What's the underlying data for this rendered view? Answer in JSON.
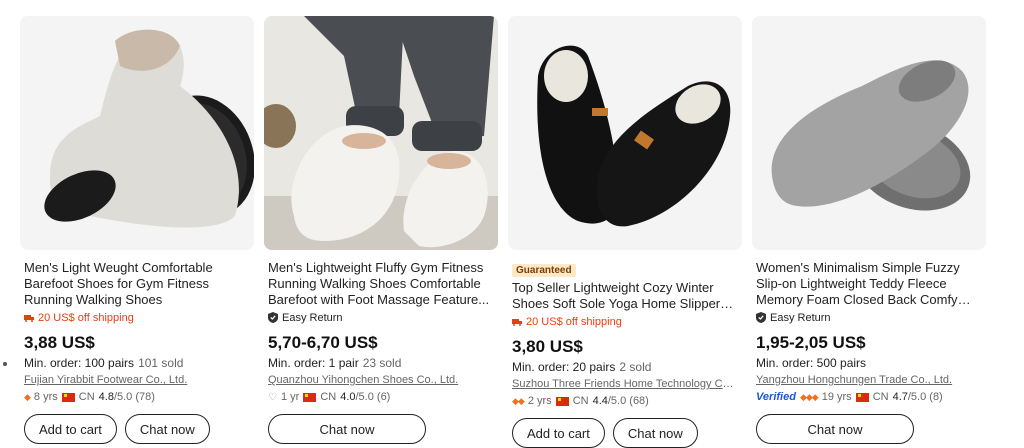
{
  "products": [
    {
      "title": "Men's Light Weught Comfortable Barefoot Shoes for Gym Fitness Running Walking Shoes",
      "badge": "",
      "promo": "20 US$ off shipping",
      "easy_return": "",
      "price": "3,88 US$",
      "min_order": "Min. order: 100 pairs",
      "sold": "101 sold",
      "supplier": "Fujian Yirabbit Footwear Co., Ltd.",
      "years": "8 yrs",
      "country": "CN",
      "rating": "4.8",
      "rating_suffix": "/5.0 (78)",
      "add_to_cart": "Add to cart",
      "chat": "Chat now",
      "icon": "diamond-icon",
      "image_color": "#dcdcd8"
    },
    {
      "title": "Men's Lightweight Fluffy Gym Fitness Running Walking Shoes Comfortable Barefoot with Foot Massage Feature...",
      "badge": "",
      "promo": "",
      "easy_return": "Easy Return",
      "price": "5,70-6,70 US$",
      "min_order": "Min. order: 1 pair",
      "sold": "23 sold",
      "supplier": "Quanzhou Yihongchen Shoes Co., Ltd.",
      "years": "1 yr",
      "country": "CN",
      "rating": "4.0",
      "rating_suffix": "/5.0 (6)",
      "add_to_cart": "",
      "chat": "Chat now",
      "icon": "heart-icon",
      "image_color": "#e7e5e0"
    },
    {
      "title": "Top Seller Lightweight Cozy Winter Shoes Soft Sole Yoga Home Slippers fo...",
      "badge": "Guaranteed",
      "promo": "20 US$ off shipping",
      "easy_return": "",
      "price": "3,80 US$",
      "min_order": "Min. order: 20 pairs",
      "sold": "2 sold",
      "supplier": "Suzhou Three Friends Home Technology Co.,...",
      "years": "2 yrs",
      "country": "CN",
      "rating": "4.4",
      "rating_suffix": "/5.0 (68)",
      "add_to_cart": "Add to cart",
      "chat": "Chat now",
      "icon": "diamond-icon",
      "image_color": "#111111"
    },
    {
      "title": "Women's Minimalism Simple Fuzzy Slip-on Lightweight Teddy Fleece Memory Foam Closed Back Comfy Indoor Hous...",
      "badge": "",
      "promo": "",
      "easy_return": "Easy Return",
      "price": "1,95-2,05 US$",
      "min_order": "Min. order: 500 pairs",
      "sold": "",
      "supplier": "Yangzhou Hongchungen Trade Co., Ltd.",
      "verified": "Verified",
      "years": "19 yrs",
      "country": "CN",
      "rating": "4.7",
      "rating_suffix": "/5.0 (8)",
      "add_to_cart": "",
      "chat": "Chat now",
      "icon": "diamond-icon",
      "image_color": "#9a9a9a"
    }
  ],
  "colors": {
    "promo": "#e8400c",
    "accent_diamond": "#f37021",
    "verified": "#1a56db"
  }
}
